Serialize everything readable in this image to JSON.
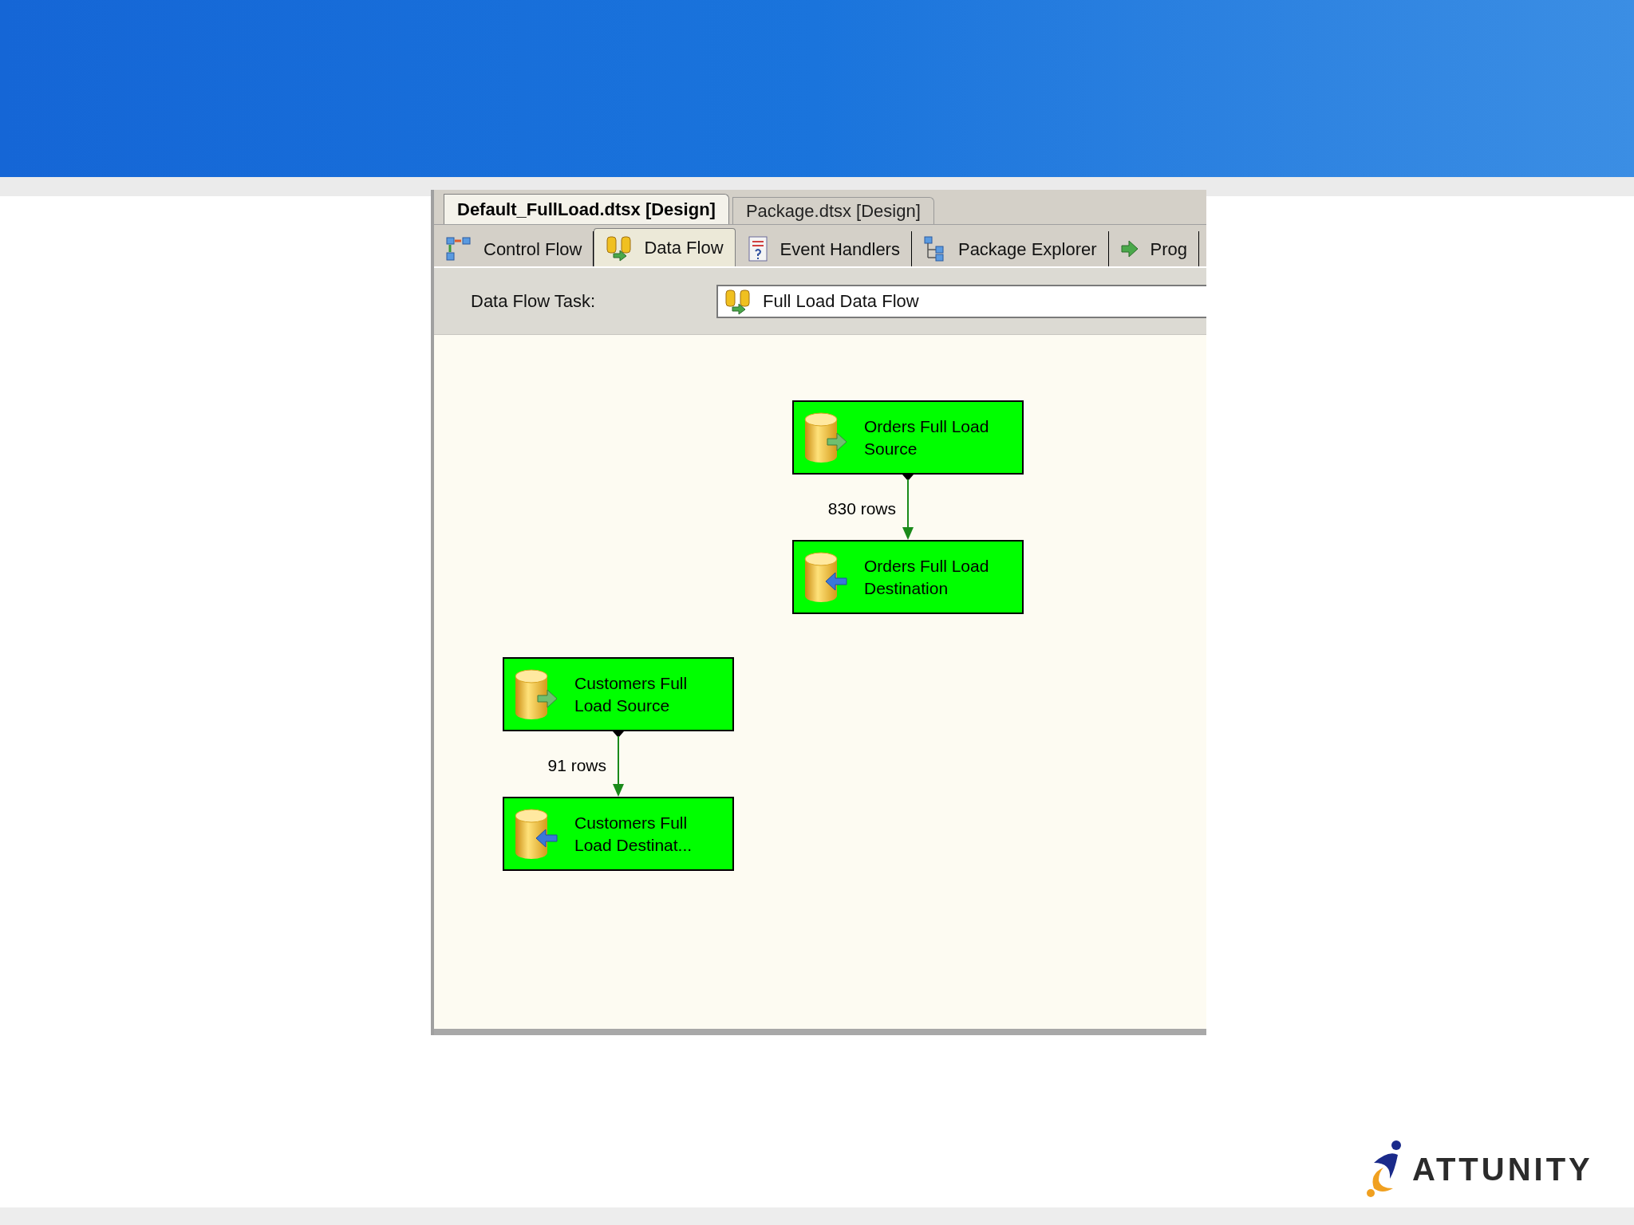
{
  "document_tabs": [
    {
      "label": "Default_FullLoad.dtsx [Design]",
      "selected": true
    },
    {
      "label": "Package.dtsx [Design]",
      "selected": false
    }
  ],
  "designer_tabs": [
    {
      "label": "Control Flow",
      "kind": "control",
      "selected": false
    },
    {
      "label": "Data Flow",
      "kind": "data",
      "selected": true
    },
    {
      "label": "Event Handlers",
      "kind": "events",
      "selected": false
    },
    {
      "label": "Package Explorer",
      "kind": "explorer",
      "selected": false
    },
    {
      "label": "Prog",
      "kind": "progress",
      "selected": false
    }
  ],
  "task_selector": {
    "label": "Data Flow Task:",
    "value": "Full Load Data Flow"
  },
  "flows": [
    {
      "source": "Orders Full Load Source",
      "destination": "Orders Full Load Destination",
      "rows": "830 rows"
    },
    {
      "source": "Customers Full Load Source",
      "destination": "Customers Full Load Destinat...",
      "rows": "91 rows"
    }
  ],
  "logo": {
    "text": "ATTUNITY"
  }
}
